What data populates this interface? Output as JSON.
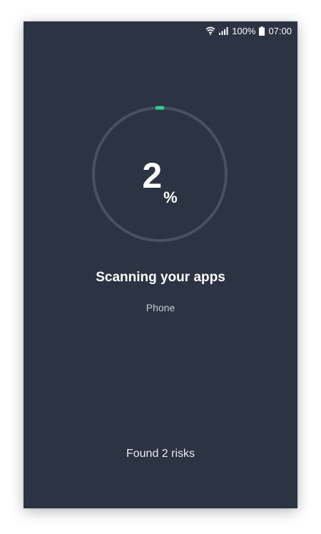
{
  "status_bar": {
    "battery_percent": "100%",
    "time": "07:00",
    "icons": [
      "wifi-icon",
      "signal-icon",
      "battery-icon"
    ]
  },
  "scan": {
    "progress_percent": 2,
    "progress_value": "2",
    "progress_unit": "%",
    "title": "Scanning your apps",
    "current_app": "Phone",
    "risks_found": "Found 2 risks"
  },
  "colors": {
    "background": "#2c3343",
    "ring_track": "#4a5060",
    "ring_progress": "#2fd28a",
    "text": "#ffffff"
  }
}
